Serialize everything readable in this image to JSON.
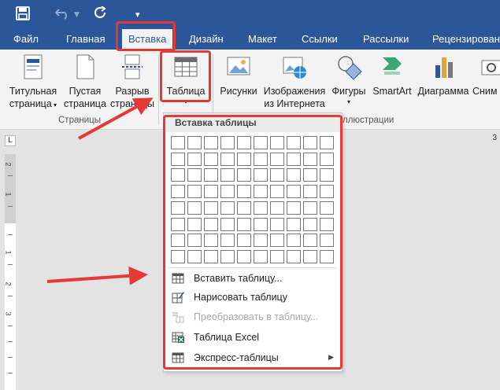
{
  "quick_access": {
    "save_icon": "save-icon",
    "undo_icon": "undo-icon",
    "redo_icon": "redo-icon",
    "customize_icon": "customize-qat-icon"
  },
  "tabs": [
    {
      "label": "Файл"
    },
    {
      "label": "Главная"
    },
    {
      "label": "Вставка",
      "active": true
    },
    {
      "label": "Дизайн"
    },
    {
      "label": "Макет"
    },
    {
      "label": "Ссылки"
    },
    {
      "label": "Рассылки"
    },
    {
      "label": "Рецензирован"
    }
  ],
  "ribbon": {
    "pages_group": {
      "label": "Страницы",
      "cover": {
        "line1": "Титульная",
        "line2": "страница"
      },
      "blank": {
        "line1": "Пустая",
        "line2": "страница"
      },
      "break": {
        "line1": "Разрыв",
        "line2": "страницы"
      }
    },
    "tables_group": {
      "table": {
        "label": "Таблица"
      }
    },
    "illustrations_group": {
      "label": "Иллюстрации",
      "label_visible": "ллюстрации",
      "pictures": {
        "label": "Рисунки"
      },
      "online_pictures": {
        "line1": "Изображения",
        "line2": "из Интернета"
      },
      "shapes": {
        "label": "Фигуры"
      },
      "smartart": {
        "label": "SmartArt"
      },
      "chart": {
        "label": "Диаграмма"
      },
      "screenshot": {
        "label": "Сним"
      }
    }
  },
  "document": {
    "corner_symbol": "L",
    "right_digit": "3",
    "ruler_numbers": [
      "2",
      "1",
      "1",
      "2",
      "3"
    ]
  },
  "dropdown": {
    "header": "Вставка таблицы",
    "grid": {
      "columns": 10,
      "rows": 8
    },
    "items": [
      {
        "label": "Вставить таблицу...",
        "icon": "insert-table-icon",
        "enabled": true
      },
      {
        "label": "Нарисовать таблицу",
        "icon": "draw-table-icon",
        "enabled": true
      },
      {
        "label": "Преобразовать в таблицу...",
        "icon": "convert-to-table-icon",
        "enabled": false
      },
      {
        "label": "Таблица Excel",
        "icon": "excel-table-icon",
        "enabled": true
      },
      {
        "label": "Экспресс-таблицы",
        "icon": "quick-tables-icon",
        "enabled": true,
        "submenu": true
      }
    ]
  },
  "colors": {
    "accent": "#2b579a",
    "highlight": "#e53935",
    "ribbon_bg": "#f3f3f3"
  }
}
